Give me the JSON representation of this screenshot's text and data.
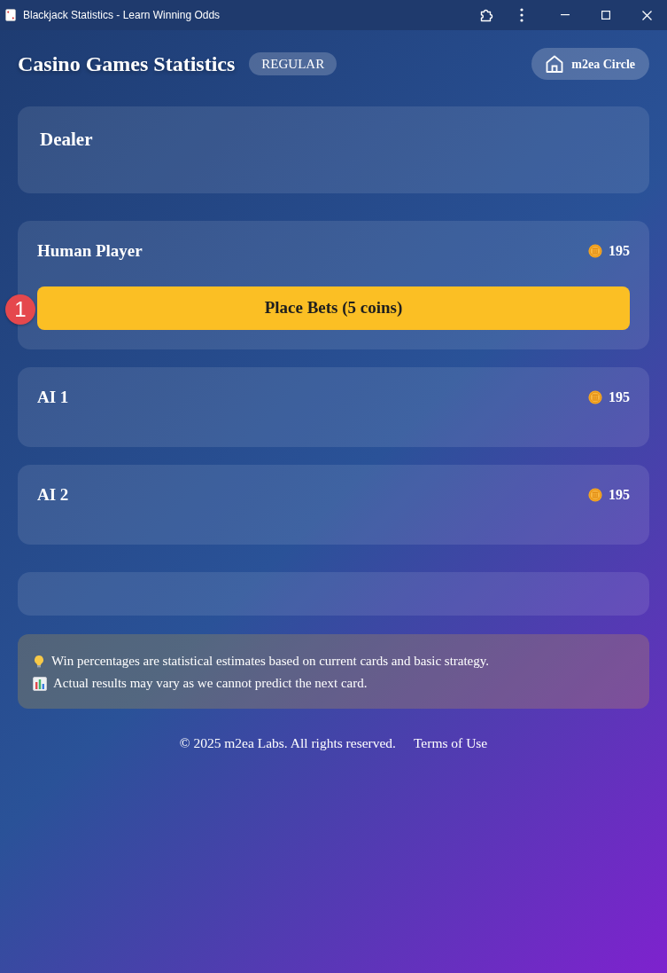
{
  "window": {
    "title": "Blackjack Statistics - Learn Winning Odds"
  },
  "header": {
    "title": "Casino Games Statistics",
    "mode_badge": "REGULAR",
    "home_button": "m2ea Circle"
  },
  "dealer": {
    "name": "Dealer"
  },
  "players": [
    {
      "name": "Human Player",
      "coins": "195",
      "action": "Place Bets (5 coins)",
      "marker": "1"
    },
    {
      "name": "AI 1",
      "coins": "195"
    },
    {
      "name": "AI 2",
      "coins": "195"
    }
  ],
  "notes": [
    {
      "kind": "tip",
      "text": "Win percentages are statistical estimates based on current cards and basic strategy."
    },
    {
      "kind": "stats",
      "text": "Actual results may vary as we cannot predict the next card."
    }
  ],
  "footer": {
    "copyright": "© 2025 m2ea Labs. All rights reserved.",
    "link": "Terms of Use"
  }
}
